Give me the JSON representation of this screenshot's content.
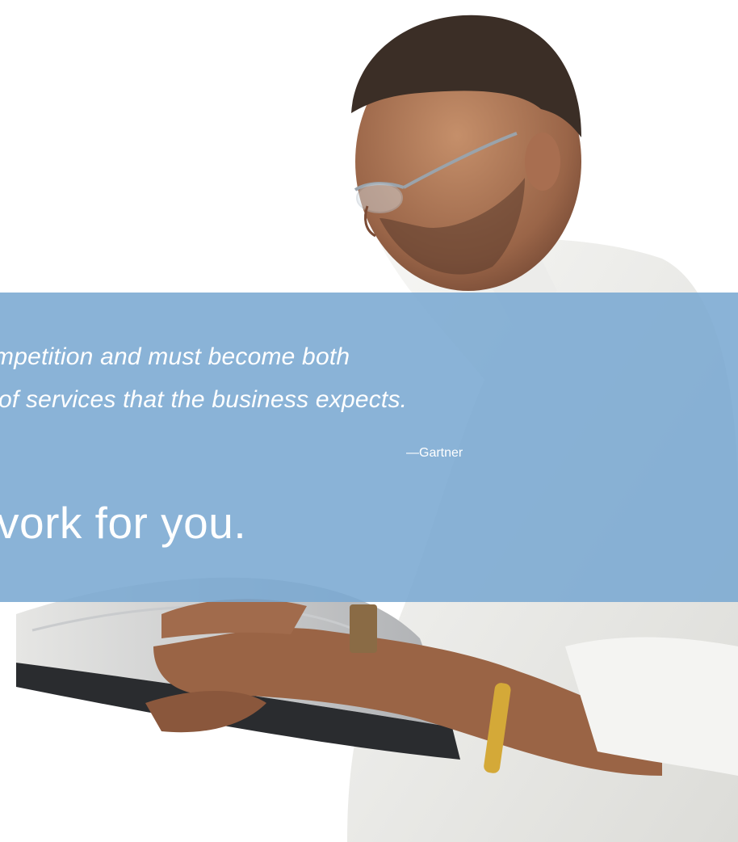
{
  "quote": {
    "line1": "mpetition and must become both",
    "line2": "of services that the business expects.",
    "attribution": "—Gartner"
  },
  "headline": "vork for you.",
  "photo": {
    "description_icon": "man-with-laptop-photo"
  },
  "colors": {
    "band": "#7aa8d2",
    "text": "#ffffff",
    "background": "#ffffff"
  }
}
